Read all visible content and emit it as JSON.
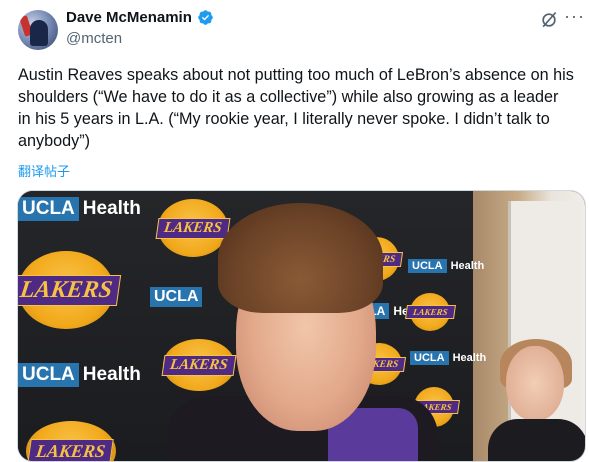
{
  "author": {
    "name": "Dave McMenamin",
    "handle": "@mcten",
    "verified": true
  },
  "actions": {
    "grok_icon": "grok-icon",
    "more_label": "···"
  },
  "tweet": {
    "text": "Austin Reaves speaks about not putting too much of LeBron’s absence on his shoulders (“We have to do it as a collective”) while also growing as a leader in his 5 years in L.A. (“My rookie year, I literally never spoke. I didn’t talk to anybody”)",
    "translate_label": "翻译帖子"
  },
  "media": {
    "backdrop_brand_lakers": "LAKERS",
    "backdrop_brand_ucla": "UCLA",
    "backdrop_brand_health": "Health"
  },
  "colors": {
    "link": "#1d9bf0",
    "secondary_text": "#536471",
    "verified_blue": "#1d9bf0"
  }
}
